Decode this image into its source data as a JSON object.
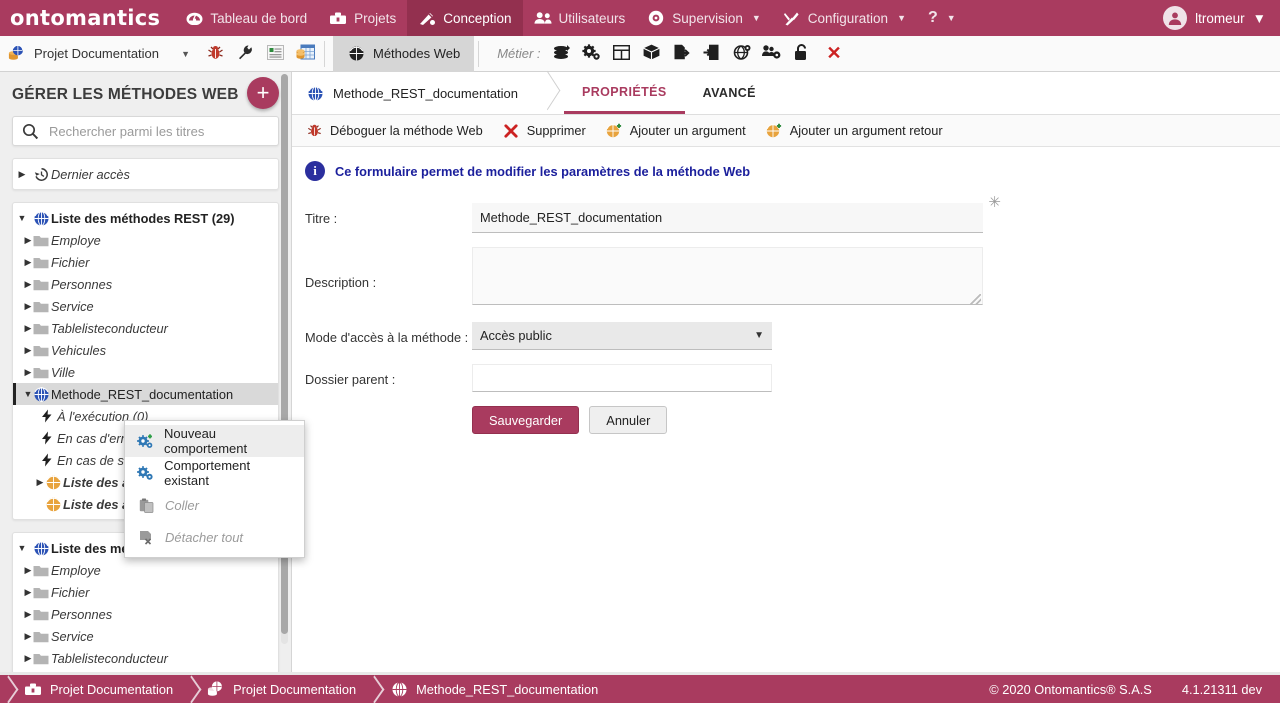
{
  "topnav": {
    "brand": "ontomantics",
    "items": [
      {
        "label": "Tableau de bord",
        "icon": "dashboard-icon",
        "caret": false,
        "active": false
      },
      {
        "label": "Projets",
        "icon": "toolbox-icon",
        "caret": false,
        "active": false
      },
      {
        "label": "Conception",
        "icon": "design-icon",
        "caret": false,
        "active": true
      },
      {
        "label": "Utilisateurs",
        "icon": "users-icon",
        "caret": false,
        "active": false
      },
      {
        "label": "Supervision",
        "icon": "eye-icon",
        "caret": true,
        "active": false
      },
      {
        "label": "Configuration",
        "icon": "tools-icon",
        "caret": true,
        "active": false
      },
      {
        "label": "?",
        "icon": "help-icon",
        "caret": true,
        "active": false
      }
    ],
    "user": "ltromeur",
    "accent": "#a93b5f",
    "accent_dark": "#93304f"
  },
  "toolbar": {
    "project": "Projet Documentation",
    "icons": [
      "bug-icon",
      "wrench-icon",
      "report-icon",
      "database-table-icon"
    ],
    "tab_web_methods": "Méthodes Web",
    "metier_label": "Métier :",
    "metier_icons": [
      "stack-layers-icon",
      "gears-icon",
      "grid-table-icon",
      "cube-icon",
      "export-file-icon",
      "import-file-icon",
      "globe-gear-icon",
      "team-gear-icon",
      "unlock-icon"
    ],
    "close_label": "✕"
  },
  "sidebar": {
    "title": "GÉRER LES MÉTHODES WEB",
    "add_button": "+",
    "search": {
      "placeholder": "Rechercher parmi les titres",
      "value": ""
    },
    "recent": {
      "label": "Dernier accès",
      "icon": "history-icon"
    },
    "groups": [
      {
        "label": "Liste des méthodes REST (29)",
        "icon": "globe-icon",
        "expanded": true,
        "items": [
          {
            "label": "Employe",
            "icon": "folder-icon",
            "indent": 1,
            "twist": "collapsed",
            "style": "italic"
          },
          {
            "label": "Fichier",
            "icon": "folder-icon",
            "indent": 1,
            "twist": "collapsed",
            "style": "italic"
          },
          {
            "label": "Personnes",
            "icon": "folder-icon",
            "indent": 1,
            "twist": "collapsed",
            "style": "italic"
          },
          {
            "label": "Service",
            "icon": "folder-icon",
            "indent": 1,
            "twist": "collapsed",
            "style": "italic"
          },
          {
            "label": "Tablelisteconducteur",
            "icon": "folder-icon",
            "indent": 1,
            "twist": "collapsed",
            "style": "italic"
          },
          {
            "label": "Vehicules",
            "icon": "folder-icon",
            "indent": 1,
            "twist": "collapsed",
            "style": "italic"
          },
          {
            "label": "Ville",
            "icon": "folder-icon",
            "indent": 1,
            "twist": "collapsed",
            "style": "italic"
          },
          {
            "label": "Methode_REST_documentation",
            "icon": "globe-icon",
            "indent": 1,
            "twist": "expanded",
            "style": "plain",
            "selected": true
          },
          {
            "label": "À l'exécution (0)",
            "icon": "bolt-icon",
            "indent": 2,
            "twist": "none",
            "style": "italic"
          },
          {
            "label": "En cas d'erreur (0)",
            "icon": "bolt-icon",
            "indent": 2,
            "twist": "none",
            "style": "italic"
          },
          {
            "label": "En cas de succès (0)",
            "icon": "bolt-icon",
            "indent": 2,
            "twist": "none",
            "style": "italic"
          },
          {
            "label": "Liste des arguments (0)",
            "icon": "arg-icon",
            "indent": 2,
            "twist": "collapsed",
            "style": "bold-italic"
          },
          {
            "label": "Liste des arguments retour (0)",
            "icon": "arg-icon",
            "indent": 2,
            "twist": "none",
            "style": "bold-italic"
          }
        ]
      },
      {
        "label": "Liste des méthodes SOAP (25)",
        "icon": "globe-icon",
        "expanded": true,
        "items": [
          {
            "label": "Employe",
            "icon": "folder-icon",
            "indent": 1,
            "twist": "collapsed",
            "style": "italic"
          },
          {
            "label": "Fichier",
            "icon": "folder-icon",
            "indent": 1,
            "twist": "collapsed",
            "style": "italic"
          },
          {
            "label": "Personnes",
            "icon": "folder-icon",
            "indent": 1,
            "twist": "collapsed",
            "style": "italic"
          },
          {
            "label": "Service",
            "icon": "folder-icon",
            "indent": 1,
            "twist": "collapsed",
            "style": "italic"
          },
          {
            "label": "Tablelisteconducteur",
            "icon": "folder-icon",
            "indent": 1,
            "twist": "collapsed",
            "style": "italic"
          }
        ]
      }
    ]
  },
  "context_menu": {
    "items": [
      {
        "label": "Nouveau comportement",
        "icon": "gears-plus-icon",
        "disabled": false,
        "highlighted": true
      },
      {
        "label": "Comportement existant",
        "icon": "gears-icon",
        "disabled": false,
        "highlighted": false
      },
      {
        "label": "Coller",
        "icon": "paste-icon",
        "disabled": true,
        "highlighted": false
      },
      {
        "label": "Détacher tout",
        "icon": "detach-icon",
        "disabled": true,
        "highlighted": false
      }
    ]
  },
  "main": {
    "crumb_tab": {
      "label": "Methode_REST_documentation",
      "icon": "globe-icon"
    },
    "tabs": [
      {
        "label": "PROPRIÉTÉS",
        "active": true
      },
      {
        "label": "AVANCÉ",
        "active": false
      }
    ],
    "actions": [
      {
        "label": "Déboguer la méthode Web",
        "icon": "bug-icon"
      },
      {
        "label": "Supprimer",
        "icon": "red-x-icon"
      },
      {
        "label": "Ajouter un argument",
        "icon": "arg-plus-icon"
      },
      {
        "label": "Ajouter un argument retour",
        "icon": "arg-plus-icon"
      }
    ],
    "info_text": "Ce formulaire permet de modifier les paramètres de la méthode Web",
    "info_icon": "info-icon",
    "form": {
      "title_label": "Titre :",
      "title_value": "Methode_REST_documentation",
      "title_required": "✳",
      "description_label": "Description :",
      "description_value": "",
      "access_label": "Mode d'accès à la méthode :",
      "access_value": "Accès public",
      "parent_label": "Dossier parent :",
      "parent_value": "",
      "save_label": "Sauvegarder",
      "cancel_label": "Annuler"
    }
  },
  "statusbar": {
    "crumbs": [
      {
        "label": "Projet Documentation",
        "icon": "toolbox-icon"
      },
      {
        "label": "Projet Documentation",
        "icon": "db-globe-icon"
      },
      {
        "label": "Methode_REST_documentation",
        "icon": "globe-icon"
      }
    ],
    "copyright": "© 2020 Ontomantics® S.A.S",
    "version": "4.1.21311 dev"
  }
}
